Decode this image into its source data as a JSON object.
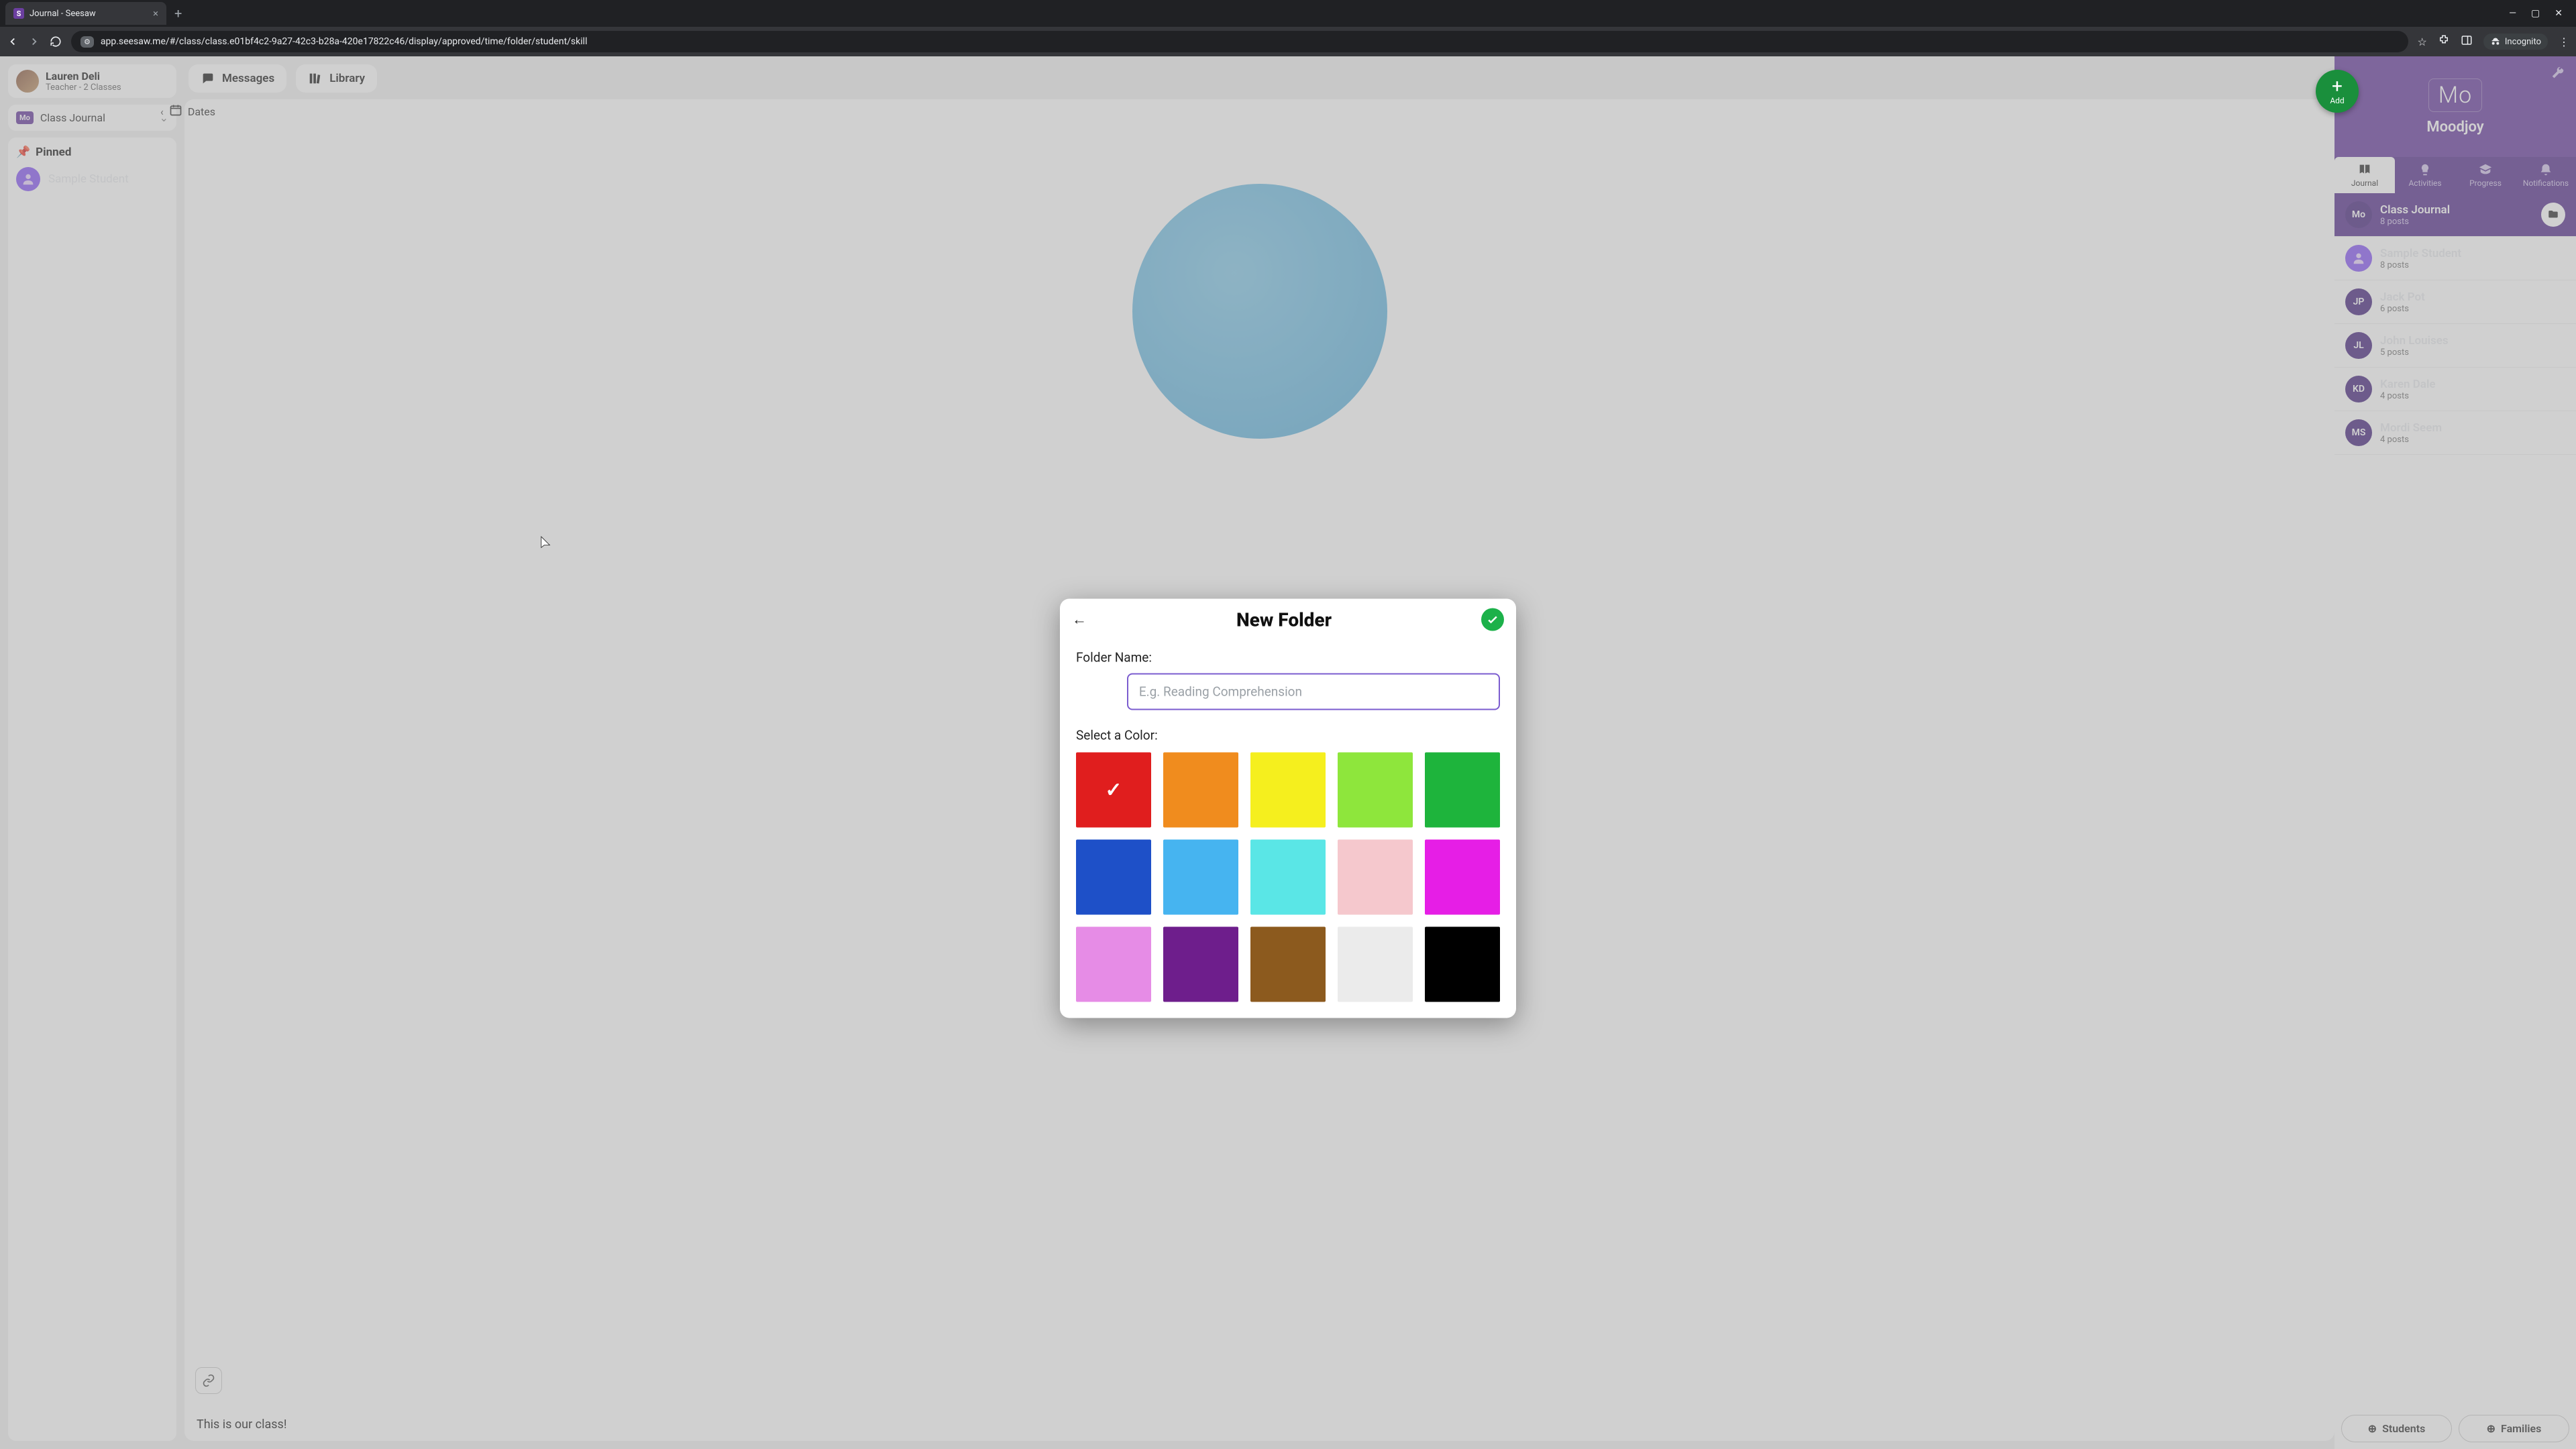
{
  "browser": {
    "tab_title": "Journal - Seesaw",
    "url": "app.seesaw.me/#/class/class.e01bf4c2-9a27-42c3-b28a-420e17822c46/display/approved/time/folder/student/skill",
    "incognito_label": "Incognito"
  },
  "teacher": {
    "name": "Lauren Deli",
    "subtitle": "Teacher - 2 Classes"
  },
  "journal_selector": {
    "badge": "Mo",
    "label": "Class Journal"
  },
  "pinned_label": "Pinned",
  "sample_student_label": "Sample Student",
  "mid_nav": {
    "messages": "Messages",
    "library": "Library",
    "dates": "Dates"
  },
  "post_caption": "This is our class!",
  "add_button": {
    "label": "Add"
  },
  "class_header": {
    "badge": "Mo",
    "name": "Moodjoy"
  },
  "right_tabs": {
    "journal": "Journal",
    "activities": "Activities",
    "progress": "Progress",
    "notifications": "Notifications"
  },
  "students": [
    {
      "initials": "Mo",
      "name": "Class Journal",
      "posts": "8 posts",
      "avatar_bg": "#4b2a82",
      "active": true,
      "folder": true
    },
    {
      "initials": "",
      "name": "Sample Student",
      "posts": "8 posts",
      "avatar_bg": "#8b5cf6",
      "icon": true
    },
    {
      "initials": "JP",
      "name": "Jack Pot",
      "posts": "6 posts",
      "avatar_bg": "#4b2a82"
    },
    {
      "initials": "JL",
      "name": "John Louises",
      "posts": "5 posts",
      "avatar_bg": "#4b2a82"
    },
    {
      "initials": "KD",
      "name": "Karen Dale",
      "posts": "4 posts",
      "avatar_bg": "#4b2a82"
    },
    {
      "initials": "MS",
      "name": "Mordi Seem",
      "posts": "4 posts",
      "avatar_bg": "#4b2a82"
    }
  ],
  "bottom": {
    "students": "Students",
    "families": "Families"
  },
  "modal": {
    "title": "New Folder",
    "folder_name_label": "Folder Name:",
    "folder_name_placeholder": "E.g. Reading Comprehension",
    "select_color_label": "Select a Color:",
    "colors": [
      {
        "hex": "#e01e1e",
        "selected": true
      },
      {
        "hex": "#f08c1e"
      },
      {
        "hex": "#f5ef1e"
      },
      {
        "hex": "#8ee63c"
      },
      {
        "hex": "#1eb43c"
      },
      {
        "hex": "#1e50c8"
      },
      {
        "hex": "#46b4f0"
      },
      {
        "hex": "#5ae6e6"
      },
      {
        "hex": "#f5c8cd"
      },
      {
        "hex": "#e61ee6"
      },
      {
        "hex": "#e68ce6"
      },
      {
        "hex": "#6e1e8c"
      },
      {
        "hex": "#8c5a1e"
      },
      {
        "hex": "#ebebeb"
      },
      {
        "hex": "#000000"
      }
    ]
  }
}
